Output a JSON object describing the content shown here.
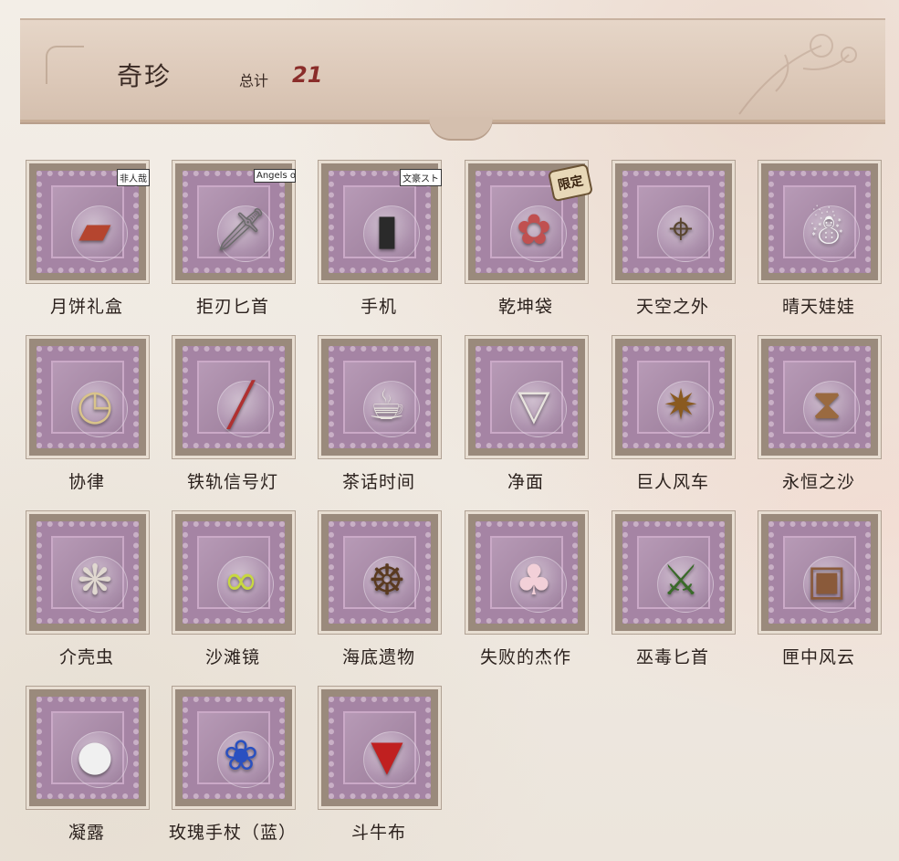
{
  "header": {
    "title": "奇珍",
    "total_label": "总计",
    "total_value": "21"
  },
  "items": [
    {
      "label": "月饼礼盒",
      "icon": "mooncake-box-icon",
      "badge": "非人哉"
    },
    {
      "label": "拒刃匕首",
      "icon": "dagger-icon",
      "badge": "Angels of Death"
    },
    {
      "label": "手机",
      "icon": "flip-phone-icon",
      "badge": "文豪ストレイドッグス"
    },
    {
      "label": "乾坤袋",
      "icon": "pouch-icon",
      "badge": "限定"
    },
    {
      "label": "天空之外",
      "icon": "telescope-icon",
      "badge": ""
    },
    {
      "label": "晴天娃娃",
      "icon": "teru-teru-bozu-icon",
      "badge": ""
    },
    {
      "label": "协律",
      "icon": "clock-icon",
      "badge": ""
    },
    {
      "label": "铁轨信号灯",
      "icon": "signal-lamp-icon",
      "badge": ""
    },
    {
      "label": "茶话时间",
      "icon": "teapot-icon",
      "badge": ""
    },
    {
      "label": "净面",
      "icon": "cloth-icon",
      "badge": ""
    },
    {
      "label": "巨人风车",
      "icon": "windmill-icon",
      "badge": ""
    },
    {
      "label": "永恒之沙",
      "icon": "hourglass-icon",
      "badge": ""
    },
    {
      "label": "介壳虫",
      "icon": "beetle-icon",
      "badge": ""
    },
    {
      "label": "沙滩镜",
      "icon": "sunglasses-icon",
      "badge": ""
    },
    {
      "label": "海底遗物",
      "icon": "ship-wheel-icon",
      "badge": ""
    },
    {
      "label": "失败的杰作",
      "icon": "doll-icon",
      "badge": ""
    },
    {
      "label": "巫毒匕首",
      "icon": "voodoo-dagger-icon",
      "badge": ""
    },
    {
      "label": "匣中风云",
      "icon": "chest-icon",
      "badge": ""
    },
    {
      "label": "凝露",
      "icon": "dew-orb-icon",
      "badge": ""
    },
    {
      "label": "玫瑰手杖（蓝）",
      "icon": "rose-cane-icon",
      "badge": ""
    },
    {
      "label": "斗牛布",
      "icon": "matador-cape-icon",
      "badge": ""
    }
  ],
  "colors": {
    "accent_total": "#8a2d2a",
    "stamp": "#a584a4",
    "background": "#f1ebe3"
  }
}
